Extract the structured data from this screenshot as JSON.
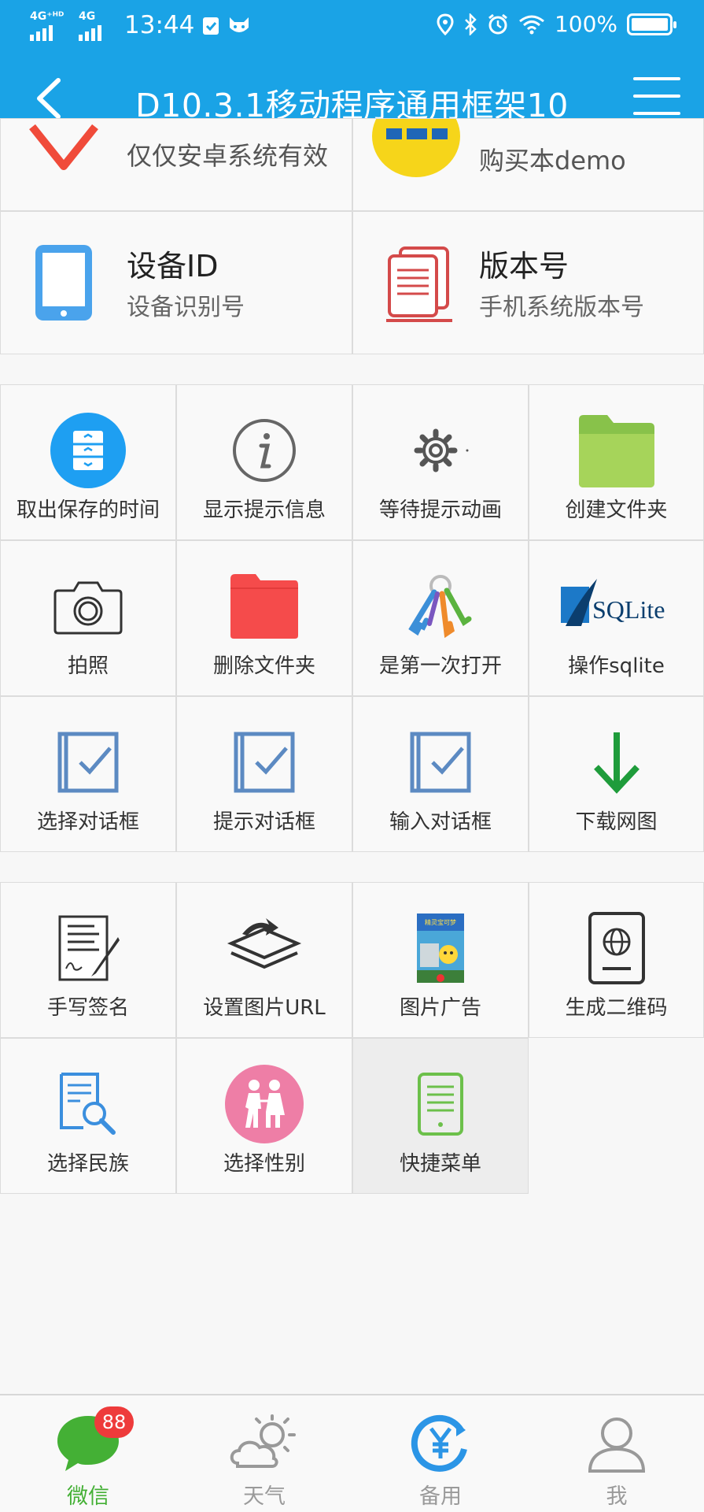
{
  "status_bar": {
    "net1": "4G⁺ᴴᴰ",
    "net2": "4G",
    "time": "13:44",
    "battery": "100%"
  },
  "nav": {
    "title": "D10.3.1移动程序通用框架10"
  },
  "top_cells": [
    {
      "title": "",
      "subtitle": "仅仅安卓系统有效",
      "icon": "heart-icon"
    },
    {
      "title": "",
      "subtitle": "购买本demo",
      "icon": "buy-logo-icon"
    },
    {
      "title": "设备ID",
      "subtitle": "设备识别号",
      "icon": "phone-icon"
    },
    {
      "title": "版本号",
      "subtitle": "手机系统版本号",
      "icon": "documents-icon"
    }
  ],
  "grid1": [
    {
      "label": "取出保存的时间",
      "icon": "cabinet-icon"
    },
    {
      "label": "显示提示信息",
      "icon": "info-icon"
    },
    {
      "label": "等待提示动画",
      "icon": "gear-icon"
    },
    {
      "label": "创建文件夹",
      "icon": "green-folder-icon"
    },
    {
      "label": "拍照",
      "icon": "camera-icon"
    },
    {
      "label": "删除文件夹",
      "icon": "red-folder-icon"
    },
    {
      "label": "是第一次打开",
      "icon": "keys-icon"
    },
    {
      "label": "操作sqlite",
      "icon": "sqlite-logo-icon"
    },
    {
      "label": "选择对话框",
      "icon": "checkbox-icon"
    },
    {
      "label": "提示对话框",
      "icon": "checkbox-icon"
    },
    {
      "label": "输入对话框",
      "icon": "checkbox-icon"
    },
    {
      "label": "下载网图",
      "icon": "download-arrow-icon"
    }
  ],
  "grid2": [
    {
      "label": "手写签名",
      "icon": "signature-icon"
    },
    {
      "label": "设置图片URL",
      "icon": "layers-icon"
    },
    {
      "label": "图片广告",
      "icon": "ad-poster-icon"
    },
    {
      "label": "生成二维码",
      "icon": "passport-icon"
    },
    {
      "label": "选择民族",
      "icon": "search-document-icon"
    },
    {
      "label": "选择性别",
      "icon": "couple-icon"
    },
    {
      "label": "快捷菜单",
      "icon": "tablet-icon"
    }
  ],
  "sqlite_logo_text": "SQLite",
  "ad_poster_text": "精灵宝可梦",
  "tabs": [
    {
      "label": "微信",
      "icon": "chat-icon",
      "badge": "88",
      "active": true
    },
    {
      "label": "天气",
      "icon": "weather-icon"
    },
    {
      "label": "备用",
      "icon": "yuan-icon"
    },
    {
      "label": "我",
      "icon": "user-icon"
    }
  ],
  "colors": {
    "primary": "#1aa3e6",
    "active_tab": "#44b035",
    "badge": "#ee3b3b"
  }
}
